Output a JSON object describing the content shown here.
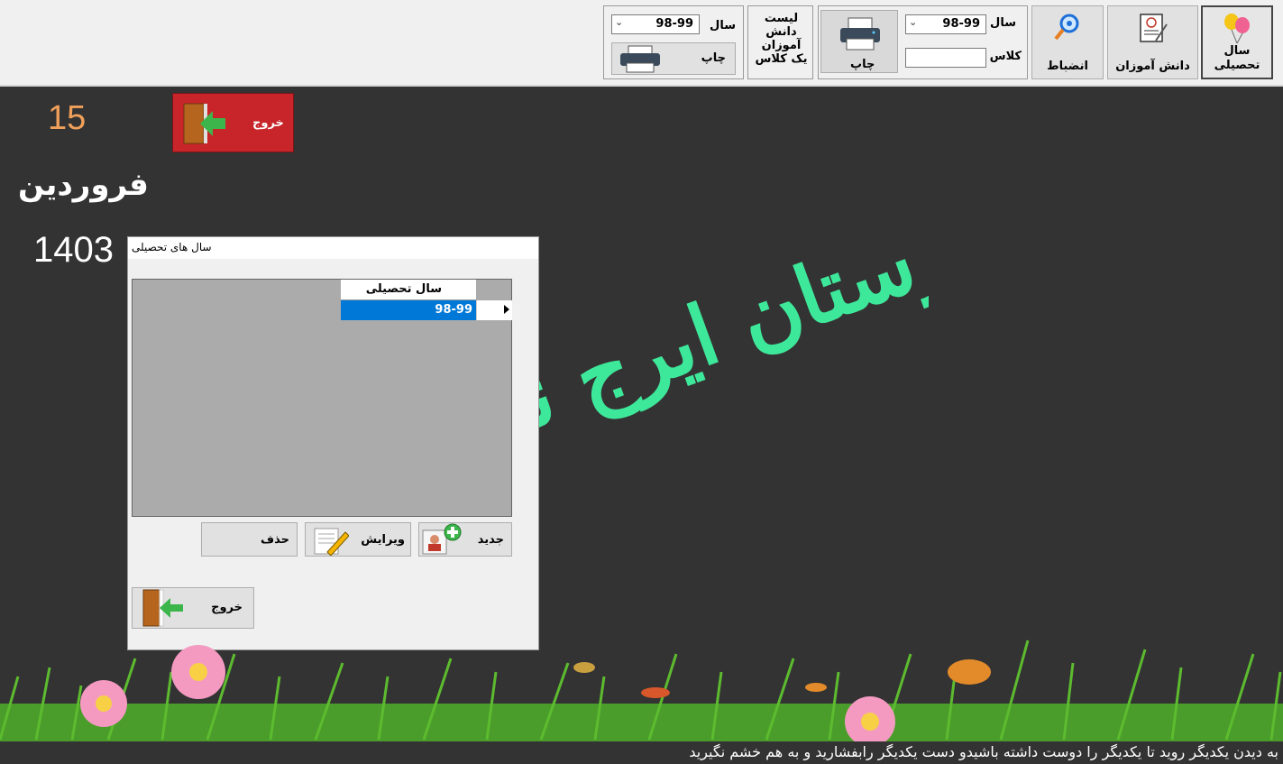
{
  "toolbar": {
    "year_button": {
      "label_line1": "سال",
      "label_line2": "تحصیلی",
      "icon": "balloons-icon"
    },
    "students_button": {
      "label": "دانش آموزان",
      "icon": "certificate-icon"
    },
    "discipline_button": {
      "label": "انضباط",
      "icon": "magnifier-icon"
    },
    "class_print_panel": {
      "year_label": "سال",
      "year_value": "98-99",
      "class_label": "کلاس",
      "class_value": "",
      "print_label": "چاپ"
    },
    "list_panel": {
      "title_lines": [
        "لیست",
        "دانش",
        "آموزان",
        "یک کلاس"
      ],
      "year_label": "سال",
      "year_value": "98-99",
      "print_label": "چاپ"
    }
  },
  "date": {
    "day": "15",
    "month": "فروردین",
    "year": "1403"
  },
  "exit_main_label": "خروج",
  "logo_text": "دبیرستان ایرج نایب",
  "dialog": {
    "title": "سال های تحصیلی",
    "grid": {
      "column_header": "سال تحصیلی",
      "rows": [
        "98-99"
      ]
    },
    "buttons": {
      "new": "جدید",
      "edit": "ویرایش",
      "delete": "حذف",
      "exit": "خروج"
    }
  },
  "footer": "به دیدن یکدیگر روید تا یکدیگر را دوست داشته باشیدو دست یکدیگر رابفشارید و به هم خشم نگیرید",
  "colors": {
    "background": "#333333",
    "exit_red": "#c8252a",
    "calligraphy_green": "#3ee89a",
    "date_day_orange": "#f0a05a",
    "selection_blue": "#0078d7"
  }
}
